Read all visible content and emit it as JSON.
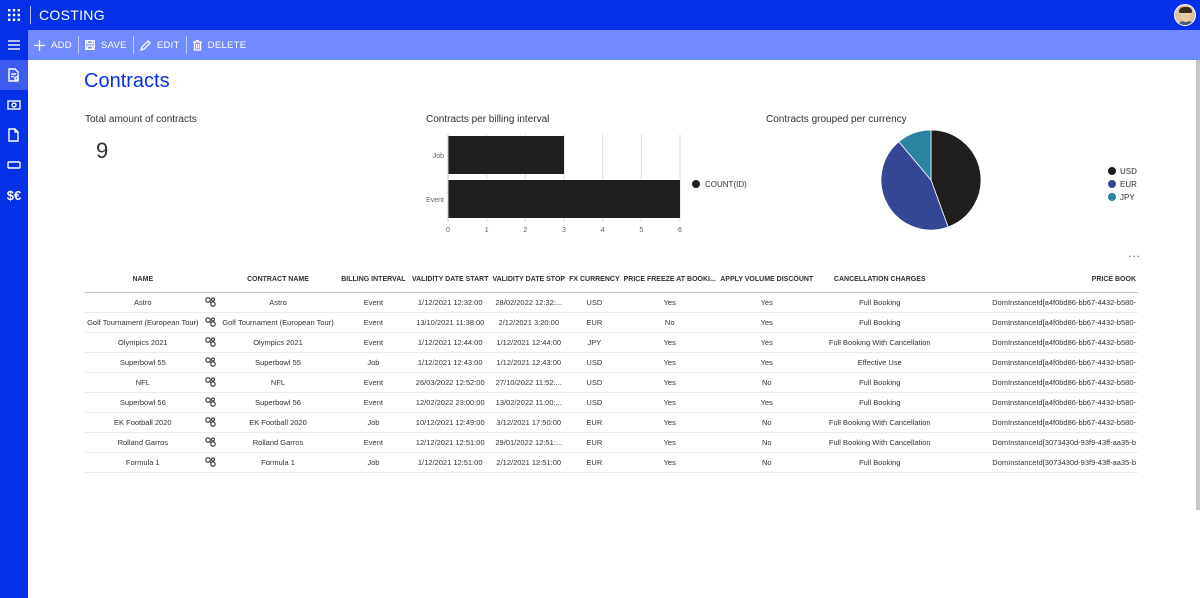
{
  "app": {
    "title": "COSTING"
  },
  "commands": [
    {
      "icon": "plus-icon",
      "label": "ADD"
    },
    {
      "icon": "save-icon",
      "label": "SAVE"
    },
    {
      "icon": "edit-icon",
      "label": "EDIT"
    },
    {
      "icon": "delete-icon",
      "label": "DELETE"
    }
  ],
  "sidebar": {
    "items": [
      {
        "icon": "hamburger-icon"
      },
      {
        "icon": "contract-doc-icon",
        "active": true
      },
      {
        "icon": "money-icon"
      },
      {
        "icon": "document-icon"
      },
      {
        "icon": "ticket-icon"
      },
      {
        "icon": "currency-icon",
        "text": "$€"
      }
    ]
  },
  "page": {
    "title": "Contracts",
    "more": "..."
  },
  "kpi": {
    "title": "Total amount of contracts",
    "value": "9"
  },
  "bar_title": "Contracts per billing interval",
  "pie_title": "Contracts grouped per currency",
  "chart_data": [
    {
      "type": "bar",
      "orientation": "horizontal",
      "title": "Contracts per billing interval",
      "categories": [
        "Job",
        "Event"
      ],
      "series": [
        {
          "name": "COUNT(ID)",
          "values": [
            3,
            6
          ],
          "color": "#201f1e"
        }
      ],
      "xlim": [
        0,
        6
      ],
      "xticks": [
        "0",
        "1",
        "2",
        "3",
        "4",
        "5",
        "6"
      ],
      "grid": true,
      "legend": "right"
    },
    {
      "type": "pie",
      "title": "Contracts grouped per currency",
      "categories": [
        "USD",
        "EUR",
        "JPY"
      ],
      "values": [
        4,
        4,
        1
      ],
      "colors": [
        "#201f1e",
        "#354694",
        "#2a84a2"
      ],
      "legend": "right"
    }
  ],
  "table": {
    "columns": [
      "NAME",
      "",
      "CONTRACT NAME",
      "BILLING INTERVAL",
      "VALIDITY DATE START",
      "VALIDITY DATE STOP",
      "FX CURRENCY",
      "PRICE FREEZE AT BOOKI...",
      "APPLY VOLUME DISCOUNT",
      "CANCELLATION CHARGES",
      "PRICE BOOK"
    ],
    "rows": [
      [
        "Astro",
        "Astro",
        "Event",
        "1/12/2021 12:32:00",
        "28/02/2022 12:32:...",
        "USD",
        "Yes",
        "Yes",
        "Full Booking",
        "DomInstanceId[a4f0bd86-bb67-4432-b580-"
      ],
      [
        "Golf Tournament (European Tour)",
        "Golf Tournament (European Tour)",
        "Event",
        "13/10/2021 11:38:00",
        "2/12/2021 3:20:00",
        "EUR",
        "No",
        "Yes",
        "Full Booking",
        "DomInstanceId[a4f0bd86-bb67-4432-b580-"
      ],
      [
        "Olympics 2021",
        "Olympics 2021",
        "Event",
        "1/12/2021 12:44:00",
        "1/12/2021 12:44:00",
        "JPY",
        "Yes",
        "Yes",
        "Full Booking With Cancellation",
        "DomInstanceId[a4f0bd86-bb67-4432-b580-"
      ],
      [
        "Superbowl 55",
        "Superbowl 55",
        "Job",
        "1/12/2021 12:43:00",
        "1/12/2021 12:43:00",
        "USD",
        "Yes",
        "Yes",
        "Effective Use",
        "DomInstanceId[a4f0bd86-bb67-4432-b580-"
      ],
      [
        "NFL",
        "NFL",
        "Event",
        "26/03/2022 12:52:00",
        "27/10/2022 11:52:...",
        "USD",
        "Yes",
        "No",
        "Full Booking",
        "DomInstanceId[a4f0bd86-bb67-4432-b580-"
      ],
      [
        "Superbowl 56",
        "Superbowl 56",
        "Event",
        "12/02/2022 23:00:00",
        "13/02/2022 11:00:...",
        "USD",
        "Yes",
        "Yes",
        "Full Booking",
        "DomInstanceId[a4f0bd86-bb67-4432-b580-"
      ],
      [
        "EK Football 2020",
        "EK Football 2020",
        "Job",
        "10/12/2021 12:49:00",
        "3/12/2021 17:50:00",
        "EUR",
        "Yes",
        "No",
        "Full Booking With Cancellation",
        "DomInstanceId[a4f0bd86-bb67-4432-b580-"
      ],
      [
        "Rolland Garros",
        "Rolland Garros",
        "Event",
        "12/12/2021 12:51:00",
        "29/01/2022 12:51:...",
        "EUR",
        "Yes",
        "No",
        "Full Booking With Cancellation",
        "DomInstanceId[3073430d-93f9-43ff-aa35-b"
      ],
      [
        "Formula 1",
        "Formula 1",
        "Job",
        "1/12/2021 12:51:00",
        "2/12/2021 12:51:00",
        "EUR",
        "Yes",
        "No",
        "Full Booking",
        "DomInstanceId[3073430d-93f9-43ff-aa35-b"
      ]
    ]
  }
}
